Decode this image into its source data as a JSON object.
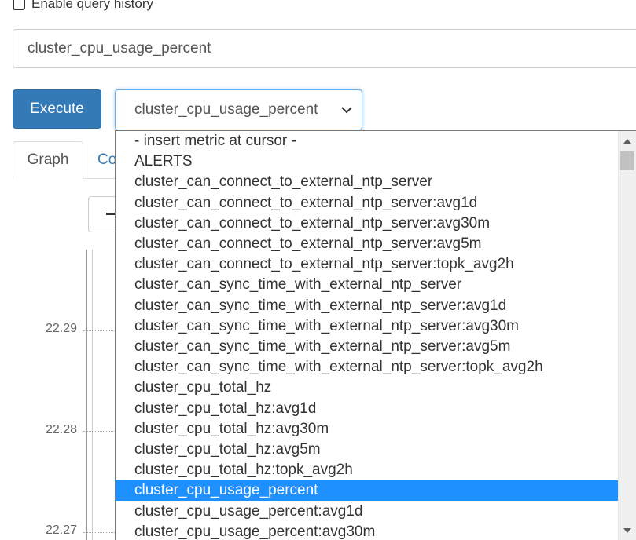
{
  "history": {
    "label": "Enable query history"
  },
  "expression": {
    "value": "cluster_cpu_usage_percent"
  },
  "execute": {
    "label": "Execute"
  },
  "metric_select": {
    "selected": "cluster_cpu_usage_percent"
  },
  "tabs": [
    {
      "label": "Graph"
    },
    {
      "label": "Co"
    }
  ],
  "graph": {
    "y_ticks": [
      "22.29",
      "22.28",
      "22.27"
    ]
  },
  "dropdown": {
    "options": [
      "- insert metric at cursor -",
      "ALERTS",
      "cluster_can_connect_to_external_ntp_server",
      "cluster_can_connect_to_external_ntp_server:avg1d",
      "cluster_can_connect_to_external_ntp_server:avg30m",
      "cluster_can_connect_to_external_ntp_server:avg5m",
      "cluster_can_connect_to_external_ntp_server:topk_avg2h",
      "cluster_can_sync_time_with_external_ntp_server",
      "cluster_can_sync_time_with_external_ntp_server:avg1d",
      "cluster_can_sync_time_with_external_ntp_server:avg30m",
      "cluster_can_sync_time_with_external_ntp_server:avg5m",
      "cluster_can_sync_time_with_external_ntp_server:topk_avg2h",
      "cluster_cpu_total_hz",
      "cluster_cpu_total_hz:avg1d",
      "cluster_cpu_total_hz:avg30m",
      "cluster_cpu_total_hz:avg5m",
      "cluster_cpu_total_hz:topk_avg2h",
      "cluster_cpu_usage_percent",
      "cluster_cpu_usage_percent:avg1d",
      "cluster_cpu_usage_percent:avg30m"
    ],
    "selected_index": 17
  },
  "colors": {
    "primary": "#337ab7",
    "selected_option": "#1e90ff"
  }
}
